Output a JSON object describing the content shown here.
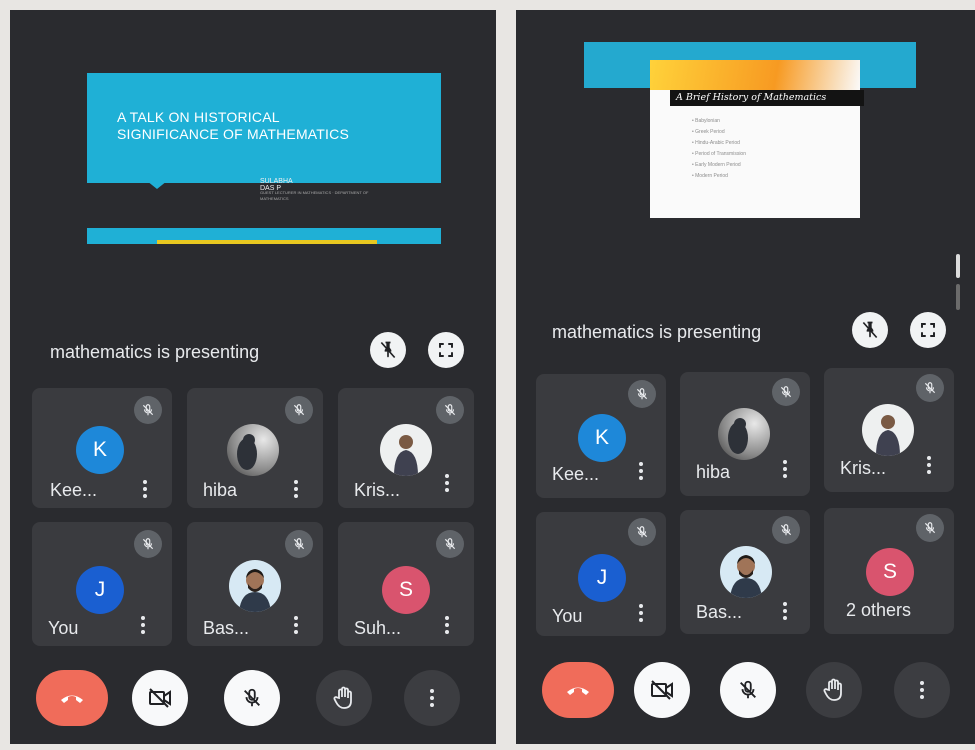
{
  "left": {
    "slide": {
      "title_line1": "A TALK ON HISTORICAL",
      "title_line2": "SIGNIFICANCE OF MATHEMATICS",
      "author": "SULABHA DAS P",
      "affiliation": "GUEST LECTURER IN MATHEMATICS · DEPARTMENT OF MATHEMATICS"
    },
    "presenting_text": "mathematics is presenting",
    "tiles": [
      {
        "label": "Kee...",
        "initial": "K",
        "avatar_color": "#1e88d9",
        "kind": "initial"
      },
      {
        "label": "hiba",
        "kind": "photo-silhouette"
      },
      {
        "label": "Kris...",
        "kind": "photo-portrait"
      },
      {
        "label": "You",
        "initial": "J",
        "avatar_color": "#1a5fd1",
        "kind": "initial"
      },
      {
        "label": "Bas...",
        "kind": "photo-man"
      },
      {
        "label": "Suh...",
        "initial": "S",
        "avatar_color": "#d9546e",
        "kind": "initial"
      }
    ]
  },
  "right": {
    "slide": {
      "title": "A Brief History of Mathematics",
      "bullets": [
        "Babylonian",
        "Greek Period",
        "Hindu-Arabic Period",
        "Period of Transmission",
        "Early Modern Period",
        "Modern Period"
      ]
    },
    "presenting_text": "mathematics is presenting",
    "tiles": [
      {
        "label": "Kee...",
        "initial": "K",
        "avatar_color": "#1e88d9",
        "kind": "initial"
      },
      {
        "label": "hiba",
        "kind": "photo-silhouette"
      },
      {
        "label": "Kris...",
        "kind": "photo-portrait"
      },
      {
        "label": "You",
        "initial": "J",
        "avatar_color": "#1a5fd1",
        "kind": "initial"
      },
      {
        "label": "Bas...",
        "kind": "photo-man"
      },
      {
        "label": "2 others",
        "initial": "S",
        "avatar_color": "#d9546e",
        "kind": "initial"
      }
    ]
  },
  "icons": {
    "unpin": "unpin-icon",
    "fullscreen": "fullscreen-icon",
    "muted": "mic-off-icon",
    "end_call": "call-end-icon",
    "camera_off": "camera-off-icon",
    "mic_off": "mic-off-icon",
    "raise_hand": "raise-hand-icon",
    "more": "more-vert-icon"
  },
  "colors": {
    "end_call": "#f06c5a",
    "background": "#2a2b2f",
    "tile": "#3a3b3f"
  }
}
